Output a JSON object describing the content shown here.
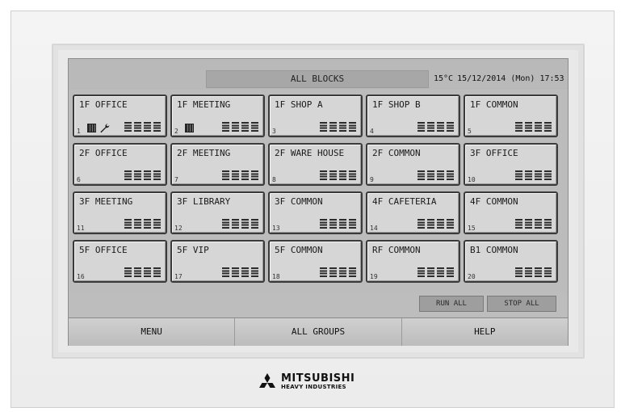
{
  "header": {
    "title": "ALL BLOCKS",
    "temperature": "15°C",
    "datetime": "15/12/2014 (Mon) 17:53"
  },
  "blocks": [
    {
      "name": "1F OFFICE",
      "number": "1",
      "icons": [
        "filter-sign",
        "inspection-wrench"
      ]
    },
    {
      "name": "1F MEETING",
      "number": "2",
      "icons": [
        "filter-sign"
      ]
    },
    {
      "name": "1F SHOP A",
      "number": "3",
      "icons": []
    },
    {
      "name": "1F SHOP B",
      "number": "4",
      "icons": []
    },
    {
      "name": "1F COMMON",
      "number": "5",
      "icons": []
    },
    {
      "name": "2F OFFICE",
      "number": "6",
      "icons": []
    },
    {
      "name": "2F MEETING",
      "number": "7",
      "icons": []
    },
    {
      "name": "2F WARE HOUSE",
      "number": "8",
      "icons": []
    },
    {
      "name": "2F COMMON",
      "number": "9",
      "icons": []
    },
    {
      "name": "3F OFFICE",
      "number": "10",
      "icons": []
    },
    {
      "name": "3F MEETING",
      "number": "11",
      "icons": []
    },
    {
      "name": "3F LIBRARY",
      "number": "12",
      "icons": []
    },
    {
      "name": "3F COMMON",
      "number": "13",
      "icons": []
    },
    {
      "name": "4F CAFETERIA",
      "number": "14",
      "icons": []
    },
    {
      "name": "4F COMMON",
      "number": "15",
      "icons": []
    },
    {
      "name": "5F OFFICE",
      "number": "16",
      "icons": []
    },
    {
      "name": "5F VIP",
      "number": "17",
      "icons": []
    },
    {
      "name": "5F COMMON",
      "number": "18",
      "icons": []
    },
    {
      "name": "RF COMMON",
      "number": "19",
      "icons": []
    },
    {
      "name": "B1 COMMON",
      "number": "20",
      "icons": []
    }
  ],
  "controls": {
    "run_all": "RUN ALL",
    "stop_all": "STOP ALL"
  },
  "nav": {
    "menu": "MENU",
    "all_groups": "ALL GROUPS",
    "help": "HELP"
  },
  "brand": {
    "line1": "MITSUBISHI",
    "line2": "HEAVY INDUSTRIES",
    "logo_icon": "three-diamonds-icon"
  },
  "colors": {
    "screen_bg": "#bcbcbc",
    "block_bg": "#d6d6d6",
    "block_border": "#3a3a3a"
  }
}
